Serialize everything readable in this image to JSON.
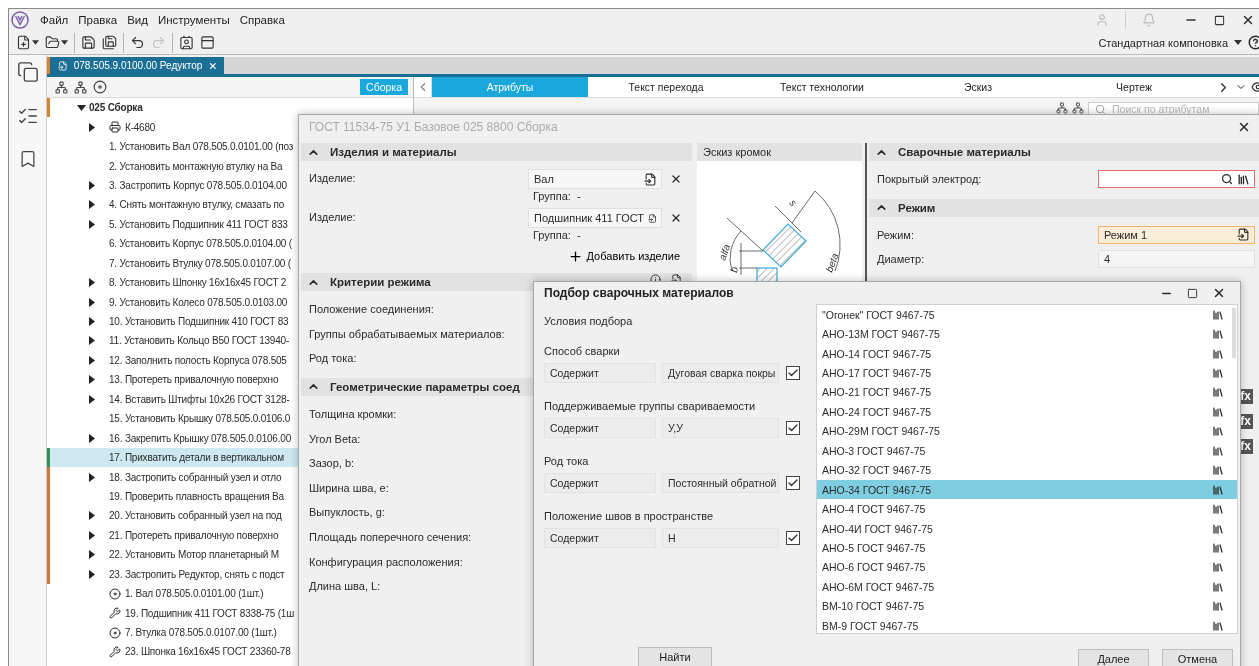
{
  "menu": [
    "Файл",
    "Правка",
    "Вид",
    "Инструменты",
    "Справка"
  ],
  "toolbar": [
    {
      "kind": "new",
      "dropdown": true,
      "disabled": false,
      "separator_before": false
    },
    {
      "kind": "open",
      "dropdown": true,
      "disabled": false,
      "separator_before": false
    },
    {
      "kind": "save",
      "dropdown": false,
      "disabled": false,
      "separator_before": true
    },
    {
      "kind": "save_as",
      "dropdown": false,
      "disabled": false,
      "separator_before": false
    },
    {
      "kind": "undo",
      "dropdown": false,
      "disabled": false,
      "separator_before": true
    },
    {
      "kind": "redo",
      "dropdown": false,
      "disabled": true,
      "separator_before": false
    },
    {
      "kind": "card",
      "dropdown": false,
      "disabled": false,
      "separator_before": true
    },
    {
      "kind": "window",
      "dropdown": false,
      "disabled": false,
      "separator_before": false
    }
  ],
  "layout_selector": "Стандартная компоновка",
  "document_tab": {
    "title": "078.505.9.0100.00 Редуктор",
    "selected": true
  },
  "tree": {
    "mode_label": "Сборка",
    "items": [
      {
        "label": "025 Сборка",
        "kind": "assembly",
        "expandable": true,
        "expanded": true,
        "selected": false,
        "color": "#d9822b",
        "children": [
          {
            "label": "К-4680",
            "kind": "equipment",
            "expandable": true,
            "expanded": false,
            "selected": false
          },
          {
            "label": "1. Установить Вал 078.505.0.0101.00 (поз",
            "kind": "step",
            "expandable": false,
            "expanded": false,
            "selected": false
          },
          {
            "label": "2. Установить монтажную втулку на Ва",
            "kind": "step",
            "expandable": false,
            "expanded": false,
            "selected": false
          },
          {
            "label": "3. Застропить Корпус 078.505.0.0104.00",
            "kind": "step",
            "expandable": true,
            "expanded": false,
            "selected": false
          },
          {
            "label": "4. Снять монтажную втулку, смазать по",
            "kind": "step",
            "expandable": true,
            "expanded": false,
            "selected": false
          },
          {
            "label": "5. Установить Подшипник 411 ГОСТ 833",
            "kind": "step",
            "expandable": true,
            "expanded": false,
            "selected": false
          },
          {
            "label": "6. Установить Корпус 078.505.0.0104.00 (",
            "kind": "step",
            "expandable": false,
            "expanded": false,
            "selected": false
          },
          {
            "label": "7. Установить Втулку 078.505.0.0107.00 (",
            "kind": "step",
            "expandable": false,
            "expanded": false,
            "selected": false
          },
          {
            "label": "8. Установить Шпонку 16х16х45 ГОСТ 2",
            "kind": "step",
            "expandable": true,
            "expanded": false,
            "selected": false
          },
          {
            "label": "9. Установить Колесо 078.505.0.0103.00",
            "kind": "step",
            "expandable": true,
            "expanded": false,
            "selected": false
          },
          {
            "label": "10. Установить Подшипник 410 ГОСТ 83",
            "kind": "step",
            "expandable": true,
            "expanded": false,
            "selected": false
          },
          {
            "label": "11. Установить Кольцо В50 ГОСТ 13940-",
            "kind": "step",
            "expandable": true,
            "expanded": false,
            "selected": false
          },
          {
            "label": "12. Заполнить полость Корпуса 078.505",
            "kind": "step",
            "expandable": true,
            "expanded": false,
            "selected": false
          },
          {
            "label": "13. Протереть привалочную поверхно",
            "kind": "step",
            "expandable": true,
            "expanded": false,
            "selected": false
          },
          {
            "label": "14. Вставить Штифты 10х26 ГОСТ 3128-",
            "kind": "step",
            "expandable": true,
            "expanded": false,
            "selected": false
          },
          {
            "label": "15. Установить Крышку 078.505.0.0106.0",
            "kind": "step",
            "expandable": false,
            "expanded": false,
            "selected": false
          },
          {
            "label": "16. Закрепить Крышку 078.505.0.0106.00",
            "kind": "step",
            "expandable": true,
            "expanded": false,
            "selected": false
          },
          {
            "label": "17. Прихватить детали в вертикальном",
            "kind": "step",
            "expandable": false,
            "expanded": false,
            "selected": true,
            "color": "#2f8f57"
          },
          {
            "label": "18. Застропить собранный узел и отло",
            "kind": "step",
            "expandable": true,
            "expanded": false,
            "selected": false,
            "color": "#d2773a"
          },
          {
            "label": "19. Проверить плавность вращения Ва",
            "kind": "step",
            "expandable": false,
            "expanded": false,
            "selected": false,
            "color": "#d2773a"
          },
          {
            "label": "20. Установить собранный узел на под",
            "kind": "step",
            "expandable": true,
            "expanded": false,
            "selected": false,
            "color": "#d2773a"
          },
          {
            "label": "21. Протереть привалочную поверхно",
            "kind": "step",
            "expandable": true,
            "expanded": false,
            "selected": false,
            "color": "#d2773a"
          },
          {
            "label": "22. Установить Мотор планетарный М",
            "kind": "step",
            "expandable": true,
            "expanded": false,
            "selected": false,
            "color": "#d2773a"
          },
          {
            "label": "23. Застропить Редуктор, снять с подст",
            "kind": "step",
            "expandable": true,
            "expanded": false,
            "selected": false,
            "color": "#d2773a"
          },
          {
            "label": "1. Вал 078.505.0.0101.00 (1шт.)",
            "kind": "part",
            "expandable": false,
            "expanded": false,
            "selected": false
          },
          {
            "label": "19. Подшипник 411 ГОСТ 8338-75 (1ш",
            "kind": "standard_part",
            "expandable": false,
            "expanded": false,
            "selected": false
          },
          {
            "label": "7. Втулка 078.505.0.0107.00 (1шт.)",
            "kind": "part",
            "expandable": false,
            "expanded": false,
            "selected": false
          },
          {
            "label": "23. Шпонка 16х16х45 ГОСТ 23360-78",
            "kind": "standard_part",
            "expandable": false,
            "expanded": false,
            "selected": false
          }
        ]
      }
    ]
  },
  "attribute_tabs": [
    {
      "label": "Атрибуты",
      "selected": true
    },
    {
      "label": "Текст перехода",
      "selected": false
    },
    {
      "label": "Текст технологии",
      "selected": false
    },
    {
      "label": "Эскиз",
      "selected": false
    },
    {
      "label": "Чертеж",
      "selected": false
    }
  ],
  "attribute_search": {
    "placeholder": "Поиск по атрибутам"
  },
  "operation_dialog": {
    "title": "ГОСТ 11534-75 У1 Базовое 025  8800 Сборка",
    "left_sections": [
      {
        "title": "Изделия и материалы",
        "expanded": true,
        "kind": "products",
        "products": [
          {
            "label": "Изделие:",
            "value": "Вал",
            "group": "Группа:  -"
          },
          {
            "label": "Изделие:",
            "value": "Подшипник 411 ГОСТ",
            "group": "Группа:  -"
          }
        ],
        "add": "Добавить изделие"
      },
      {
        "title": "Критерии режима",
        "expanded": true,
        "kind": "fields",
        "rows": [
          "Положение соединения:",
          "Группы обрабатываемых материалов:",
          "Род тока:"
        ]
      },
      {
        "title": "Геометрические параметры соед",
        "expanded": true,
        "kind": "fields",
        "rows": [
          "Толщина кромки:",
          "Угол Beta:",
          "Зазор, b:",
          "Ширина шва, e:",
          "Выпуклость, g:",
          "Площадь поперечного сечения:",
          "Конфигурация расположения:",
          "Длина шва, L:"
        ]
      }
    ],
    "sketch": {
      "title": "Эскиз кромок",
      "labels": [
        "s",
        "alfa",
        "b",
        "beta"
      ]
    },
    "right_sections": [
      {
        "title": "Сварочные материалы",
        "expanded": true,
        "rows": [
          {
            "label": "Покрытый электрод:",
            "kind": "lookup",
            "error": true,
            "highlighted": false
          }
        ]
      },
      {
        "title": "Режим",
        "expanded": true,
        "rows": [
          {
            "label": "Режим:",
            "value": "Режим 1",
            "kind": "select",
            "error": false,
            "highlighted": true
          },
          {
            "label": "Диаметр:",
            "value": "4",
            "kind": "text",
            "error": false,
            "highlighted": false
          }
        ]
      }
    ],
    "formula_badges": [
      "fx",
      "fx",
      "fx"
    ]
  },
  "selection_dialog": {
    "title": "Подбор сварочных материалов",
    "conditions_title": "Условия подбора",
    "conditions": [
      {
        "label": "Способ сварки",
        "operator": "Содержит",
        "value": "Дуговая сварка покры",
        "checked": true
      },
      {
        "label": "Поддерживаемые группы свариваемости",
        "operator": "Содержит",
        "value": "У,У",
        "checked": true
      },
      {
        "label": "Род тока",
        "operator": "Содержит",
        "value": "Постоянный обратной",
        "checked": true
      },
      {
        "label": "Положение швов в пространстве",
        "operator": "Содержит",
        "value": "Н",
        "checked": true
      }
    ],
    "find_button": "Найти",
    "materials": [
      {
        "label": "\"Огонек\" ГОСТ 9467-75",
        "selected": false
      },
      {
        "label": "АНО-13М ГОСТ 9467-75",
        "selected": false
      },
      {
        "label": "АНО-14 ГОСТ 9467-75",
        "selected": false
      },
      {
        "label": "АНО-17 ГОСТ 9467-75",
        "selected": false
      },
      {
        "label": "АНО-21 ГОСТ 9467-75",
        "selected": false
      },
      {
        "label": "АНО-24 ГОСТ 9467-75",
        "selected": false
      },
      {
        "label": "АНО-29М ГОСТ 9467-75",
        "selected": false
      },
      {
        "label": "АНО-3 ГОСТ 9467-75",
        "selected": false
      },
      {
        "label": "АНО-32 ГОСТ 9467-75",
        "selected": false
      },
      {
        "label": "АНО-34 ГОСТ 9467-75",
        "selected": true
      },
      {
        "label": "АНО-4 ГОСТ 9467-75",
        "selected": false
      },
      {
        "label": "АНО-4И ГОСТ 9467-75",
        "selected": false
      },
      {
        "label": "АНО-5 ГОСТ 9467-75",
        "selected": false
      },
      {
        "label": "АНО-6 ГОСТ 9467-75",
        "selected": false
      },
      {
        "label": "АНО-6М ГОСТ 9467-75",
        "selected": false
      },
      {
        "label": "ВМ-10 ГОСТ 9467-75",
        "selected": false
      },
      {
        "label": "ВМ-9 ГОСТ 9467-75",
        "selected": false
      }
    ],
    "buttons": [
      "Далее",
      "Отмена"
    ]
  }
}
